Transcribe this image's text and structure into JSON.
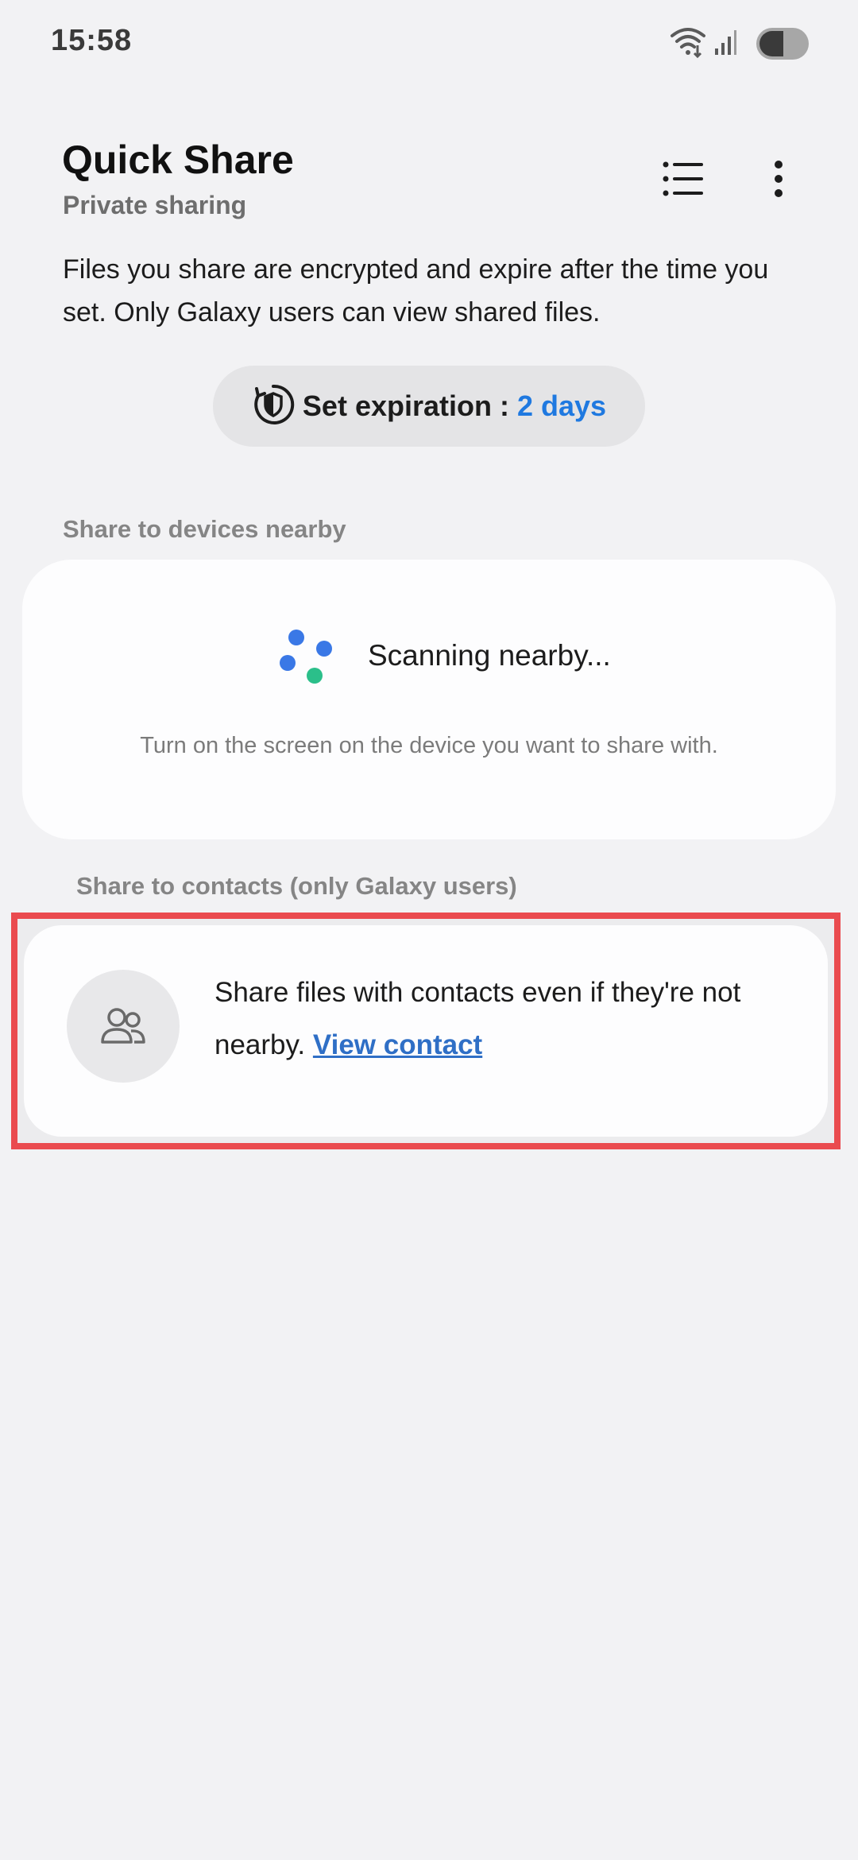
{
  "status_bar": {
    "time": "15:58"
  },
  "header": {
    "title": "Quick Share",
    "subtitle": "Private sharing"
  },
  "description": "Files you share are encrypted and expire after the time you set. Only Galaxy users can view shared files.",
  "expiration": {
    "label": "Set expiration :",
    "value": "2 days"
  },
  "nearby": {
    "section_label": "Share to devices nearby",
    "scanning_text": "Scanning nearby...",
    "hint": "Turn on the screen on the device you want to share with."
  },
  "contacts": {
    "section_label": "Share to contacts (only Galaxy users)",
    "text": "Share files with contacts even if they're not nearby.",
    "link_label": "View contact"
  },
  "colors": {
    "accent_blue": "#1f79e0",
    "link_blue": "#2f6fc6",
    "highlight_red": "#ea4b4f",
    "scan_dot_blue": "#3a78e6",
    "scan_dot_green": "#2bbf8a"
  },
  "icons": {
    "wifi": "wifi-icon",
    "signal": "signal-icon",
    "list": "list-icon",
    "more": "more-vertical-icon",
    "shield": "shield-timer-icon",
    "contacts": "people-icon"
  }
}
